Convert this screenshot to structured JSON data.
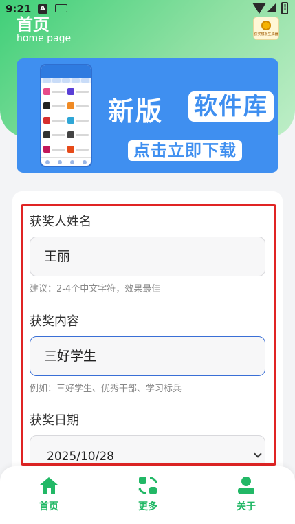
{
  "status_bar": {
    "time": "9:21",
    "icons": [
      "a-notification-icon",
      "keyboard-icon",
      "wifi-icon",
      "signal-icon",
      "battery-alert-icon"
    ]
  },
  "header": {
    "title": "首页",
    "subtitle": "home page",
    "logo_text": "获奖模板生成器"
  },
  "banner": {
    "title_plain": "新版",
    "title_boxed": "软件库",
    "cta": "点击立即下载",
    "color": "#3f8ff0"
  },
  "form": {
    "name": {
      "label": "获奖人姓名",
      "value": "王丽",
      "hint": "建议：2-4个中文字符，效果最佳"
    },
    "award": {
      "label": "获奖内容",
      "value": "三好学生",
      "hint": "例如：三好学生、优秀干部、学习标兵"
    },
    "date": {
      "label": "获奖日期",
      "value": "2025/10/28"
    }
  },
  "bottom_nav": {
    "accent": "#22b866",
    "items": [
      {
        "label": "首页",
        "icon": "home-icon"
      },
      {
        "label": "更多",
        "icon": "refresh-grid-icon"
      },
      {
        "label": "关于",
        "icon": "user-icon"
      }
    ]
  }
}
